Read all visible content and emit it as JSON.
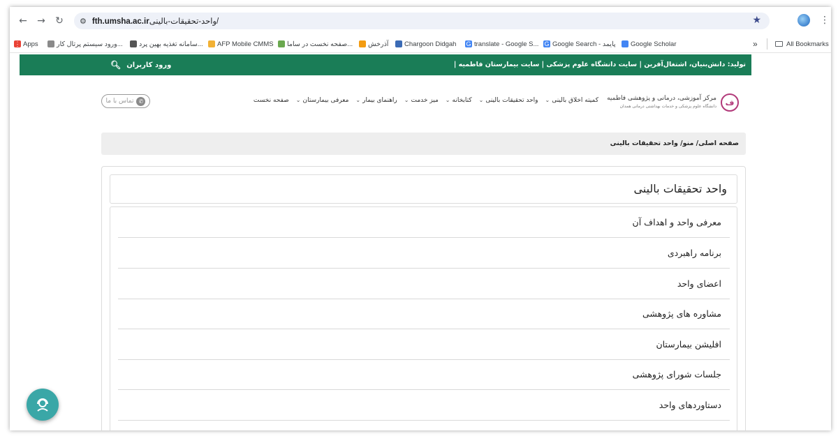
{
  "browser": {
    "url_path": "واحد-تحقیقات-بالینی/",
    "url_host": "fth.umsha.ac.ir",
    "all_bookmarks": "All Bookmarks",
    "overflow": "»",
    "bookmarks": [
      {
        "label": "Apps",
        "icon": "apps-grid-icon",
        "color": "#e94235"
      },
      {
        "label": "ورود سیستم پرتال کار...",
        "icon": "portal-icon",
        "color": "#8a8a8a"
      },
      {
        "label": "سامانه تغذیه بهین پرد...",
        "icon": "nutrition-icon",
        "color": "#555555"
      },
      {
        "label": "AFP Mobile CMMS",
        "icon": "afp-icon",
        "color": "#f2b134"
      },
      {
        "label": "صفحه نخست در ساما...",
        "icon": "samaneh-icon",
        "color": "#6aa84f"
      },
      {
        "label": "آذرخش",
        "icon": "azarakhsh-icon",
        "color": "#f39c12"
      },
      {
        "label": "Chargoon Didgah",
        "icon": "chargoon-icon",
        "color": "#3b6bb5"
      },
      {
        "label": "translate - Google S...",
        "icon": "google-icon",
        "color": "#4285f4"
      },
      {
        "label": "Google Search - پایمد",
        "icon": "google-icon",
        "color": "#4285f4"
      },
      {
        "label": "Google Scholar",
        "icon": "scholar-icon",
        "color": "#4285f4"
      }
    ]
  },
  "site": {
    "top_bar": {
      "login": "ورود کاربران",
      "credits": "تولید: دانش‌بنیان، اشتغال‌آفرین | سایت دانشگاه علوم پزشکی | سایت بیمارستان فاطمیه |"
    },
    "contact": "تماس با ما",
    "logo_text": "مرکز آموزشی، درمانی و پژوهشی فاطمیه",
    "logo_sub": "دانشگاه علوم پزشکی و خدمات بهداشتی درمانی همدان",
    "menu": [
      {
        "label": "صفحه نخست",
        "has_children": false
      },
      {
        "label": "معرفی بیمارستان",
        "has_children": true
      },
      {
        "label": "راهنمای بیمار",
        "has_children": true
      },
      {
        "label": "میز خدمت",
        "has_children": true
      },
      {
        "label": "کتابخانه",
        "has_children": true
      },
      {
        "label": "واحد تحقیقات بالینی",
        "has_children": true
      },
      {
        "label": "کمیته اخلاق بالینی",
        "has_children": true
      }
    ],
    "breadcrumb": "صفحه اصلی/ منو/ واحد تحقیقات بالینی",
    "page_title": "واحد تحقیقات بالینی",
    "items": [
      "معرفی واحد و اهداف آن",
      "برنامه راهبردی",
      "اعضای واحد",
      "مشاوره های پژوهشی",
      "افلیشن بیمارستان",
      "جلسات شورای پژوهشی",
      "دستاوردهای واحد"
    ]
  },
  "colors": {
    "brand_green": "#1a7d57",
    "support_teal": "#3aa7a7"
  }
}
